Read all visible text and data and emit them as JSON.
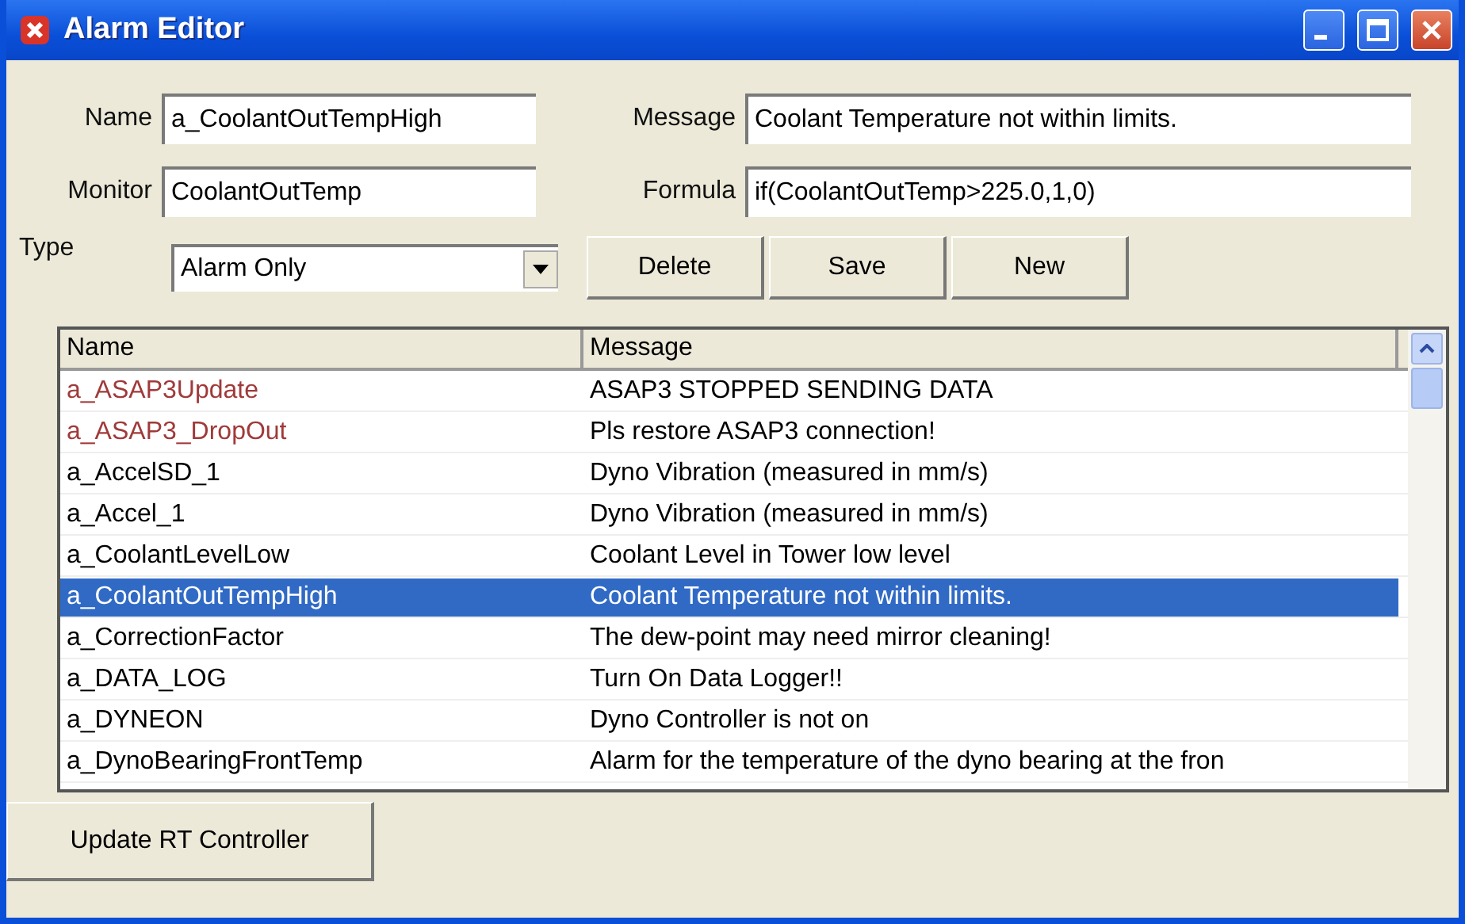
{
  "window": {
    "title": "Alarm Editor"
  },
  "form": {
    "name": {
      "label": "Name",
      "value": "a_CoolantOutTempHigh"
    },
    "message": {
      "label": "Message",
      "value": "Coolant Temperature not within limits."
    },
    "monitor": {
      "label": "Monitor",
      "value": "CoolantOutTemp"
    },
    "formula": {
      "label": "Formula",
      "value": "if(CoolantOutTemp>225.0,1,0)"
    },
    "type": {
      "label": "Type",
      "value": "Alarm Only"
    }
  },
  "buttons": [
    "Delete",
    "Save",
    "New"
  ],
  "table": {
    "columns": [
      "Name",
      "Message"
    ],
    "rows": [
      {
        "name": "a_ASAP3Update",
        "message": "ASAP3 STOPPED SENDING DATA",
        "color": "#a03a3a",
        "selected": false
      },
      {
        "name": "a_ASAP3_DropOut",
        "message": "Pls restore ASAP3 connection!",
        "color": "#a03a3a",
        "selected": false
      },
      {
        "name": "a_AccelSD_1",
        "message": "Dyno Vibration (measured in mm/s)",
        "selected": false
      },
      {
        "name": "a_Accel_1",
        "message": "Dyno Vibration (measured in mm/s)",
        "selected": false
      },
      {
        "name": "a_CoolantLevelLow",
        "message": "Coolant Level in Tower low level",
        "selected": false
      },
      {
        "name": "a_CoolantOutTempHigh",
        "message": "Coolant Temperature not within limits.",
        "selected": true
      },
      {
        "name": "a_CorrectionFactor",
        "message": "The dew-point may need mirror cleaning!",
        "selected": false
      },
      {
        "name": "a_DATA_LOG",
        "message": "Turn On Data Logger!!",
        "selected": false
      },
      {
        "name": "a_DYNEON",
        "message": "Dyno Controller is not on",
        "selected": false
      },
      {
        "name": "a_DynoBearingFrontTemp",
        "message": "Alarm for the temperature of the dyno bearing at the fron",
        "selected": false
      }
    ]
  },
  "footer_button": "Update RT Controller"
}
